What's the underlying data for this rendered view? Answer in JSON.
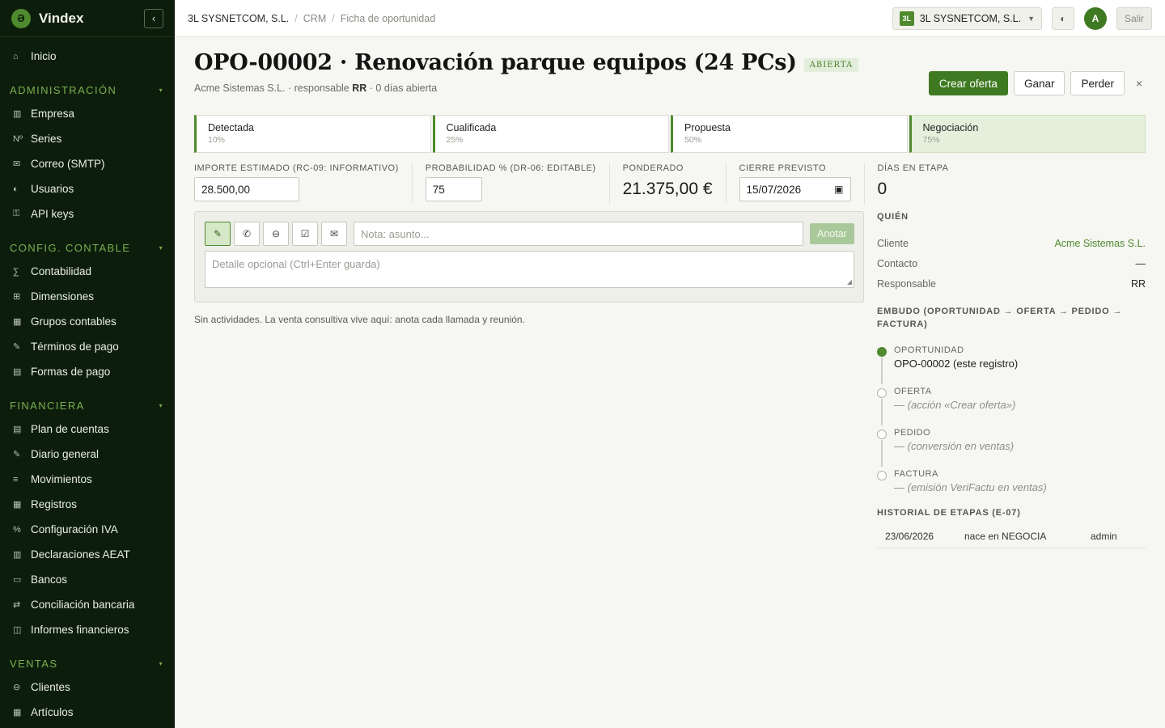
{
  "app": {
    "brand": "Vindex",
    "brand_mark": "Ə",
    "collapse": "‹"
  },
  "sidebar": {
    "home": {
      "label": "Inicio",
      "icon": "home-icon",
      "glyph": "⌂"
    },
    "sections": [
      {
        "title": "ADMINISTRACIÓN",
        "items": [
          {
            "label": "Empresa",
            "icon": "building-icon",
            "glyph": "▥"
          },
          {
            "label": "Series",
            "icon": "number-icon",
            "glyph": "Nº"
          },
          {
            "label": "Correo (SMTP)",
            "icon": "mail-icon",
            "glyph": "✉"
          },
          {
            "label": "Usuarios",
            "icon": "users-icon",
            "glyph": "◐"
          },
          {
            "label": "API keys",
            "icon": "key-icon",
            "glyph": "⚿"
          }
        ]
      },
      {
        "title": "CONFIG. CONTABLE",
        "items": [
          {
            "label": "Contabilidad",
            "icon": "sum-icon",
            "glyph": "∑"
          },
          {
            "label": "Dimensiones",
            "icon": "grid-icon",
            "glyph": "⊞"
          },
          {
            "label": "Grupos contables",
            "icon": "stack-icon",
            "glyph": "▦"
          },
          {
            "label": "Términos de pago",
            "icon": "pen-icon",
            "glyph": "✎"
          },
          {
            "label": "Formas de pago",
            "icon": "card-icon",
            "glyph": "▤"
          }
        ]
      },
      {
        "title": "FINANCIERA",
        "items": [
          {
            "label": "Plan de cuentas",
            "icon": "ledger-icon",
            "glyph": "▤"
          },
          {
            "label": "Diario general",
            "icon": "journal-icon",
            "glyph": "✎"
          },
          {
            "label": "Movimientos",
            "icon": "list-icon",
            "glyph": "≡"
          },
          {
            "label": "Registros",
            "icon": "records-icon",
            "glyph": "▦"
          },
          {
            "label": "Configuración IVA",
            "icon": "percent-icon",
            "glyph": "%"
          },
          {
            "label": "Declaraciones AEAT",
            "icon": "tax-icon",
            "glyph": "▥"
          },
          {
            "label": "Bancos",
            "icon": "bank-icon",
            "glyph": "▭"
          },
          {
            "label": "Conciliación bancaria",
            "icon": "reconcile-icon",
            "glyph": "⇄"
          },
          {
            "label": "Informes financieros",
            "icon": "report-icon",
            "glyph": "◫"
          }
        ]
      },
      {
        "title": "VENTAS",
        "items": [
          {
            "label": "Clientes",
            "icon": "client-icon",
            "glyph": "⊖"
          },
          {
            "label": "Artículos",
            "icon": "items-icon",
            "glyph": "▦"
          }
        ]
      }
    ]
  },
  "topbar": {
    "breadcrumbs": [
      "3L SYSNETCOM, S.L.",
      "CRM",
      "Ficha de oportunidad"
    ],
    "company_badge": "3L",
    "company_name": "3L SYSNETCOM, S.L.",
    "theme_icon": "◐",
    "avatar_initial": "A",
    "logout": "Salir"
  },
  "opportunity": {
    "title": "OPO-00002 · Renovación parque equipos (24 PCs)",
    "status": "ABIERTA",
    "subtitle_prefix": "Acme Sistemas S.L. · responsable ",
    "subtitle_owner": "RR",
    "subtitle_suffix": " · 0 días abierta",
    "actions": {
      "create_offer": "Crear oferta",
      "win": "Ganar",
      "lose": "Perder",
      "close": "×"
    }
  },
  "stages": [
    {
      "name": "Detectada",
      "pct": "10%"
    },
    {
      "name": "Cualificada",
      "pct": "25%"
    },
    {
      "name": "Propuesta",
      "pct": "50%"
    },
    {
      "name": "Negociación",
      "pct": "75%"
    }
  ],
  "metrics": {
    "amount": {
      "label": "IMPORTE ESTIMADO (RC-09: INFORMATIVO)",
      "value": "28.500,00"
    },
    "probability": {
      "label": "PROBABILIDAD % (DR-06: EDITABLE)",
      "value": "75"
    },
    "weighted": {
      "label": "PONDERADO",
      "value": "21.375,00 €"
    },
    "close_date": {
      "label": "CIERRE PREVISTO",
      "value": "15/07/2026"
    },
    "days_in_stage": {
      "label": "DÍAS EN ETAPA",
      "value": "0"
    }
  },
  "composer": {
    "tools": [
      {
        "name": "note-tool",
        "glyph": "✎"
      },
      {
        "name": "call-tool",
        "glyph": "✆"
      },
      {
        "name": "meeting-tool",
        "glyph": "⊖"
      },
      {
        "name": "task-tool",
        "glyph": "☑"
      },
      {
        "name": "email-tool",
        "glyph": "✉"
      }
    ],
    "subject_placeholder": "Nota: asunto...",
    "submit": "Anotar",
    "detail_placeholder": "Detalle opcional (Ctrl+Enter guarda)",
    "empty": "Sin actividades. La venta consultiva vive aquí: anota cada llamada y reunión."
  },
  "who": {
    "heading": "QUIÉN",
    "rows": [
      {
        "key": "Cliente",
        "value": "Acme Sistemas S.L."
      },
      {
        "key": "Contacto",
        "value": "—"
      },
      {
        "key": "Responsable",
        "value": "RR"
      }
    ]
  },
  "funnel": {
    "heading": "EMBUDO (OPORTUNIDAD → OFERTA → PEDIDO → FACTURA)",
    "steps": [
      {
        "label": "OPORTUNIDAD",
        "desc": "OPO-00002  (este registro)"
      },
      {
        "label": "OFERTA",
        "desc": "— (acción «Crear oferta»)"
      },
      {
        "label": "PEDIDO",
        "desc": "— (conversión en ventas)"
      },
      {
        "label": "FACTURA",
        "desc": "— (emisión VeriFactu en ventas)"
      }
    ]
  },
  "history": {
    "heading": "HISTORIAL DE ETAPAS (E-07)",
    "rows": [
      {
        "date": "23/06/2026",
        "event": "nace en NEGOCIA",
        "user": "admin"
      }
    ]
  }
}
